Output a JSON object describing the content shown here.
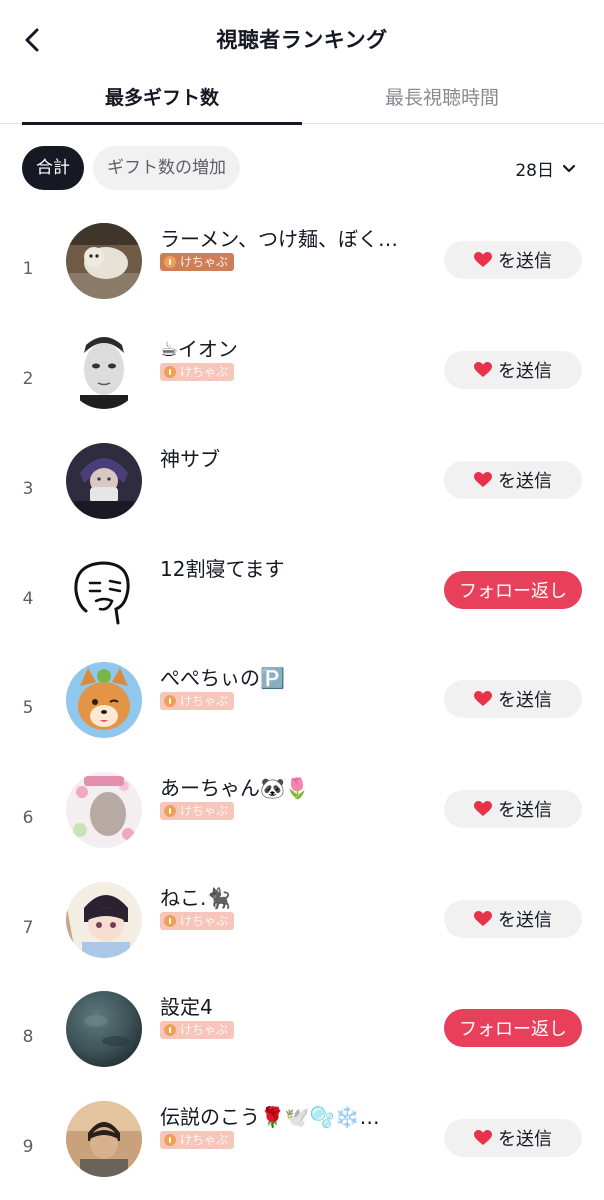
{
  "header": {
    "title": "視聴者ランキング",
    "back_icon": "chevron-left-icon"
  },
  "tabs": [
    {
      "label": "最多ギフト数",
      "active": true
    },
    {
      "label": "最長視聴時間",
      "active": false
    }
  ],
  "filters": {
    "total_label": "合計",
    "gift_increase_label": "ギフト数の増加",
    "period_value": "28日",
    "period_icon": "chevron-down-icon"
  },
  "colors": {
    "accent": "#e83f5b",
    "badge": "#f7c6bb",
    "badge_dark": "#cf7f58",
    "chip_active": "#161823"
  },
  "viewers": [
    {
      "rank": "1",
      "name": "ラーメン、つけ麺、ぼく…",
      "badge": "けちゃぶ",
      "action": "send",
      "action_label": "を送信",
      "avatar": "dog-photo"
    },
    {
      "rank": "2",
      "name": "☕イオン",
      "badge": "けちゃぶ",
      "action": "send",
      "action_label": "を送信",
      "avatar": "mask-photo"
    },
    {
      "rank": "3",
      "name": "神サブ",
      "badge": "",
      "action": "send",
      "action_label": "を送信",
      "avatar": "anime-character"
    },
    {
      "rank": "4",
      "name": "12割寝てます",
      "badge": "",
      "action": "follow",
      "action_label": "フォロー返し",
      "avatar": "sketch-face"
    },
    {
      "rank": "5",
      "name": "ぺぺちぃの🅿️",
      "badge": "けちゃぶ",
      "action": "send",
      "action_label": "を送信",
      "avatar": "shiba-cartoon"
    },
    {
      "rank": "6",
      "name": "あーちゃん🐼🌷",
      "badge": "けちゃぶ",
      "action": "send",
      "action_label": "を送信",
      "avatar": "floral-photo"
    },
    {
      "rank": "7",
      "name": "ねこ.🐈‍⬛",
      "badge": "けちゃぶ",
      "action": "send",
      "action_label": "を送信",
      "avatar": "anime-boy"
    },
    {
      "rank": "8",
      "name": "設定4",
      "badge": "けちゃぶ",
      "action": "follow",
      "action_label": "フォロー返し",
      "avatar": "planet-image"
    },
    {
      "rank": "9",
      "name": "伝説のこう🌹🕊️🫧❄️…",
      "badge": "けちゃぶ",
      "action": "send",
      "action_label": "を送信",
      "avatar": "man-portrait"
    }
  ]
}
